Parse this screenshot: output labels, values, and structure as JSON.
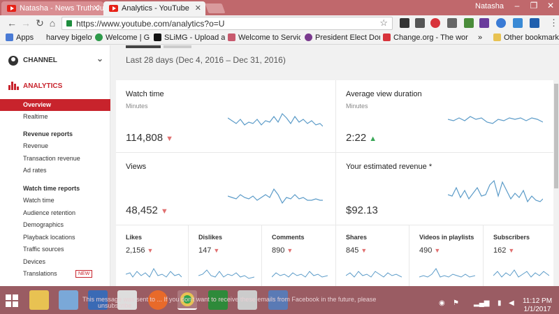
{
  "browser": {
    "tabs": [
      {
        "title": "Natasha - News Truth Ju"
      },
      {
        "title": "Analytics - YouTube"
      }
    ],
    "user": "Natasha",
    "url": "https://www.youtube.com/analytics?o=U",
    "bookmarks": {
      "apps": "Apps",
      "items": [
        "harvey bigelow",
        "Welcome | Gab",
        "SLiMG - Upload and S",
        "Welcome to Service C",
        "President Elect Donal",
        "Change.org - The wor"
      ],
      "overflow": "»",
      "other": "Other bookmarks"
    }
  },
  "sidebar": {
    "channel_label": "CHANNEL",
    "analytics_label": "ANALYTICS",
    "items": [
      {
        "label": "Overview",
        "active": true
      },
      {
        "label": "Realtime"
      }
    ],
    "revenue_heading": "Revenue reports",
    "revenue_items": [
      "Revenue",
      "Transaction revenue",
      "Ad rates"
    ],
    "watch_heading": "Watch time reports",
    "watch_items": [
      "Watch time",
      "Audience retention",
      "Demographics",
      "Playback locations",
      "Traffic sources",
      "Devices",
      "Translations"
    ],
    "new_badge": "NEW"
  },
  "main": {
    "date_range": "Last 28 days (Dec 4, 2016 – Dec 31, 2016)",
    "cards": {
      "watch_time": {
        "title": "Watch time",
        "sub": "Minutes",
        "value": "114,808",
        "trend": "down"
      },
      "avg_view": {
        "title": "Average view duration",
        "sub": "Minutes",
        "value": "2:22",
        "trend": "up"
      },
      "views": {
        "title": "Views",
        "value": "48,452",
        "trend": "down"
      },
      "revenue": {
        "title": "Your estimated revenue *",
        "value": "$92.13"
      }
    },
    "small_cards": [
      {
        "title": "Likes",
        "value": "2,156"
      },
      {
        "title": "Dislikes",
        "value": "147"
      },
      {
        "title": "Comments",
        "value": "890"
      },
      {
        "title": "Shares",
        "value": "845"
      },
      {
        "title": "Videos in playlists",
        "value": "490"
      },
      {
        "title": "Subscribers",
        "value": "162"
      }
    ],
    "trend_glyphs": {
      "down": "▼",
      "up": "▲"
    }
  },
  "taskbar": {
    "notification_line1": "This message was sent to ... If you don't want to receive these emails from Facebook in the future, please",
    "notification_line2": "unsubscribe.",
    "time": "11:12 PM",
    "date": "1/1/2017"
  },
  "colors": {
    "accent": "#c8232c",
    "sparkline": "#5b9bc8",
    "down": "#e07070",
    "up": "#3aa757",
    "taskbar": "#9a5c63",
    "titlebar": "#c0686c"
  }
}
